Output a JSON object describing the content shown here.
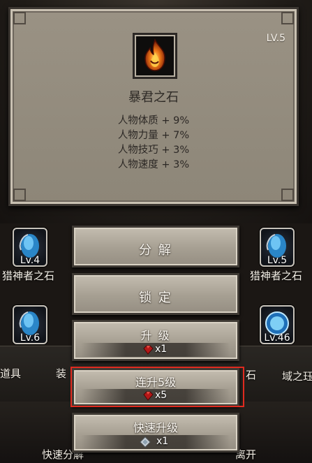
{
  "tooltip": {
    "level": "LV.5",
    "item_name": "暴君之石",
    "item_icon": "flame-stone-icon",
    "stats": [
      "人物体质 + 9%",
      "人物力量 + 7%",
      "人物技巧 + 3%",
      "人物速度 + 3%"
    ]
  },
  "side_slots": [
    {
      "level": "Lv.4",
      "name": "猎神者之石",
      "icon": "blue-crystal-icon"
    },
    {
      "level": "Lv.5",
      "name": "猎神者之石",
      "icon": "blue-crystal-icon"
    },
    {
      "level": "Lv.6",
      "name": "",
      "icon": "blue-crystal-icon"
    },
    {
      "level": "Lv.46",
      "name": "",
      "icon": "blue-orb-icon"
    }
  ],
  "background_labels": {
    "left_tab": "道具",
    "tab_fragment_1": "装",
    "tab_fragment_2": "石",
    "right_tab": "域之珏",
    "bottom_left": "快速分解",
    "bottom_right": "离开"
  },
  "actions": {
    "decompose": "分 解",
    "lock": "锁 定",
    "upgrade": {
      "label": "升 级",
      "cost": "x1",
      "cost_icon": "red-gem-icon"
    },
    "upgrade5": {
      "label": "连升5级",
      "cost": "x5",
      "cost_icon": "red-gem-icon"
    },
    "quick_upgrade": {
      "label": "快速升级",
      "cost": "x1",
      "cost_icon": "silver-gem-icon"
    }
  },
  "colors": {
    "highlight": "#e02a1f",
    "panel": "#938b7e"
  }
}
